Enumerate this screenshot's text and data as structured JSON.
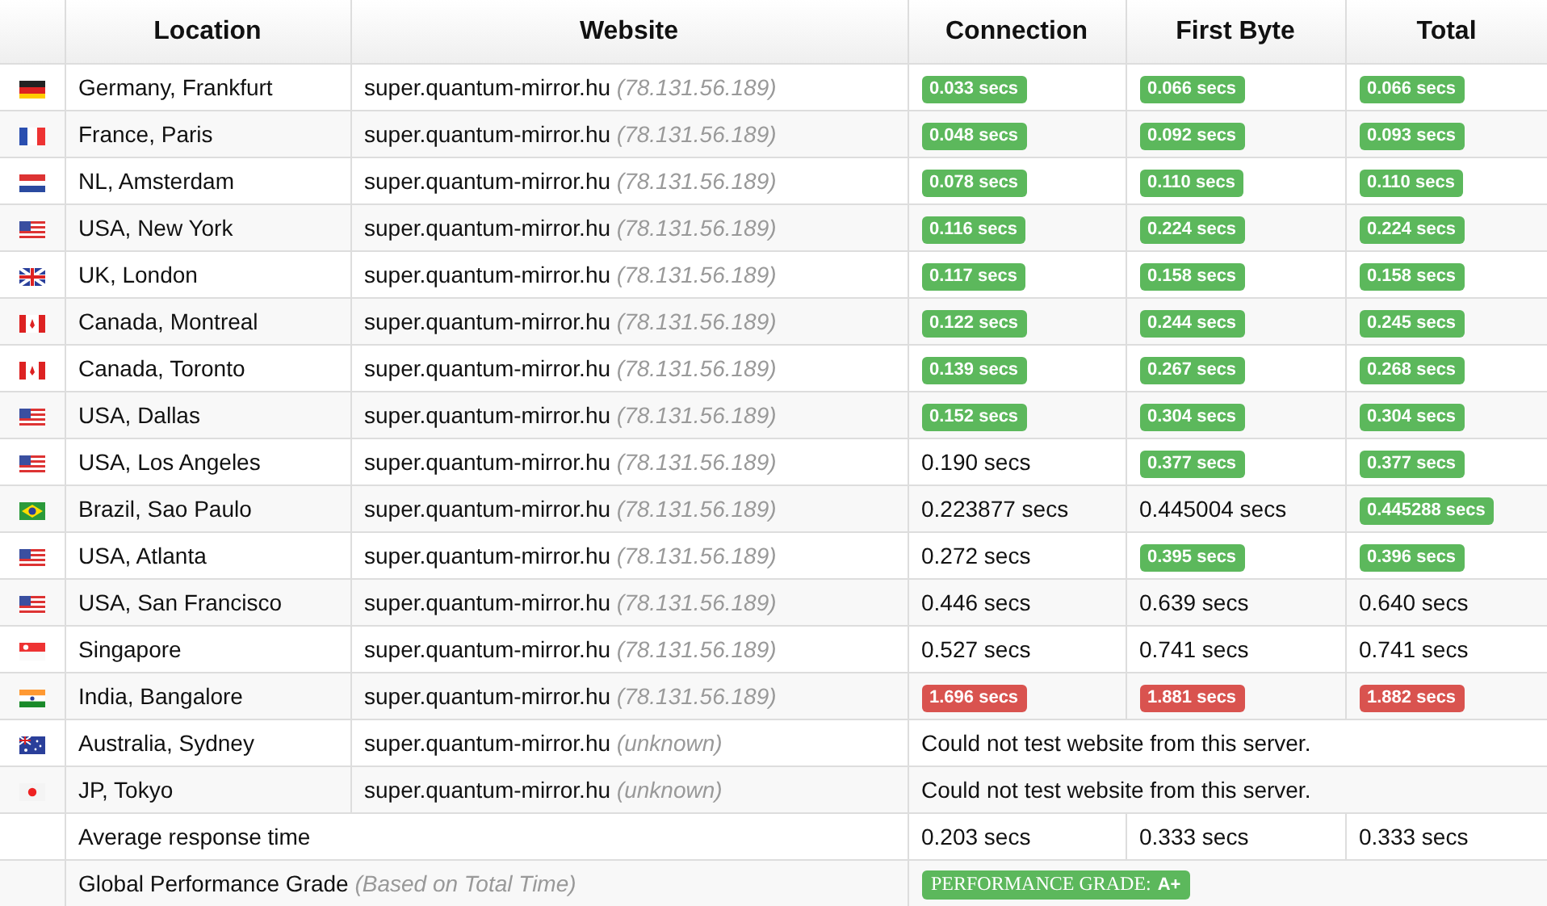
{
  "table": {
    "columns": [
      "Location",
      "Website",
      "Connection",
      "First Byte",
      "Total"
    ],
    "rows": [
      {
        "flag": {
          "kind": "de"
        },
        "location": "Germany, Frankfurt",
        "host": "super.quantum-mirror.hu",
        "ip": "(78.131.56.189)",
        "times": [
          {
            "text": "0.033 secs",
            "color": "#5cb85c"
          },
          {
            "text": "0.066 secs",
            "color": "#5cb85c"
          },
          {
            "text": "0.066 secs",
            "color": "#5cb85c"
          }
        ]
      },
      {
        "flag": {
          "kind": "fr"
        },
        "location": "France, Paris",
        "host": "super.quantum-mirror.hu",
        "ip": "(78.131.56.189)",
        "times": [
          {
            "text": "0.048 secs",
            "color": "#5cb85c"
          },
          {
            "text": "0.092 secs",
            "color": "#5cb85c"
          },
          {
            "text": "0.093 secs",
            "color": "#5cb85c"
          }
        ]
      },
      {
        "flag": {
          "kind": "nl"
        },
        "location": "NL, Amsterdam",
        "host": "super.quantum-mirror.hu",
        "ip": "(78.131.56.189)",
        "times": [
          {
            "text": "0.078 secs",
            "color": "#5cb85c"
          },
          {
            "text": "0.110 secs",
            "color": "#5cb85c"
          },
          {
            "text": "0.110 secs",
            "color": "#5cb85c"
          }
        ]
      },
      {
        "flag": {
          "kind": "us"
        },
        "location": "USA, New York",
        "host": "super.quantum-mirror.hu",
        "ip": "(78.131.56.189)",
        "times": [
          {
            "text": "0.116 secs",
            "color": "#5cb85c"
          },
          {
            "text": "0.224 secs",
            "color": "#5cb85c"
          },
          {
            "text": "0.224 secs",
            "color": "#5cb85c"
          }
        ]
      },
      {
        "flag": {
          "kind": "gb"
        },
        "location": "UK, London",
        "host": "super.quantum-mirror.hu",
        "ip": "(78.131.56.189)",
        "times": [
          {
            "text": "0.117 secs",
            "color": "#5cb85c"
          },
          {
            "text": "0.158 secs",
            "color": "#5cb85c"
          },
          {
            "text": "0.158 secs",
            "color": "#5cb85c"
          }
        ]
      },
      {
        "flag": {
          "kind": "ca"
        },
        "location": "Canada, Montreal",
        "host": "super.quantum-mirror.hu",
        "ip": "(78.131.56.189)",
        "times": [
          {
            "text": "0.122 secs",
            "color": "#5cb85c"
          },
          {
            "text": "0.244 secs",
            "color": "#5cb85c"
          },
          {
            "text": "0.245 secs",
            "color": "#5cb85c"
          }
        ]
      },
      {
        "flag": {
          "kind": "ca"
        },
        "location": "Canada, Toronto",
        "host": "super.quantum-mirror.hu",
        "ip": "(78.131.56.189)",
        "times": [
          {
            "text": "0.139 secs",
            "color": "#5cb85c"
          },
          {
            "text": "0.267 secs",
            "color": "#5cb85c"
          },
          {
            "text": "0.268 secs",
            "color": "#5cb85c"
          }
        ]
      },
      {
        "flag": {
          "kind": "us"
        },
        "location": "USA, Dallas",
        "host": "super.quantum-mirror.hu",
        "ip": "(78.131.56.189)",
        "times": [
          {
            "text": "0.152 secs",
            "color": "#5cb85c"
          },
          {
            "text": "0.304 secs",
            "color": "#5cb85c"
          },
          {
            "text": "0.304 secs",
            "color": "#5cb85c"
          }
        ]
      },
      {
        "flag": {
          "kind": "us"
        },
        "location": "USA, Los Angeles",
        "host": "super.quantum-mirror.hu",
        "ip": "(78.131.56.189)",
        "times": [
          {
            "text": "0.190 secs"
          },
          {
            "text": "0.377 secs",
            "color": "#5cb85c"
          },
          {
            "text": "0.377 secs",
            "color": "#5cb85c"
          }
        ]
      },
      {
        "flag": {
          "kind": "br"
        },
        "location": "Brazil, Sao Paulo",
        "host": "super.quantum-mirror.hu",
        "ip": "(78.131.56.189)",
        "times": [
          {
            "text": "0.223877 secs"
          },
          {
            "text": "0.445004 secs"
          },
          {
            "text": "0.445288 secs",
            "color": "#5cb85c"
          }
        ]
      },
      {
        "flag": {
          "kind": "us"
        },
        "location": "USA, Atlanta",
        "host": "super.quantum-mirror.hu",
        "ip": "(78.131.56.189)",
        "times": [
          {
            "text": "0.272 secs"
          },
          {
            "text": "0.395 secs",
            "color": "#5cb85c"
          },
          {
            "text": "0.396 secs",
            "color": "#5cb85c"
          }
        ]
      },
      {
        "flag": {
          "kind": "us"
        },
        "location": "USA, San Francisco",
        "host": "super.quantum-mirror.hu",
        "ip": "(78.131.56.189)",
        "times": [
          {
            "text": "0.446 secs"
          },
          {
            "text": "0.639 secs"
          },
          {
            "text": "0.640 secs"
          }
        ]
      },
      {
        "flag": {
          "kind": "sg"
        },
        "location": "Singapore",
        "host": "super.quantum-mirror.hu",
        "ip": "(78.131.56.189)",
        "times": [
          {
            "text": "0.527 secs"
          },
          {
            "text": "0.741 secs"
          },
          {
            "text": "0.741 secs"
          }
        ]
      },
      {
        "flag": {
          "kind": "in"
        },
        "location": "India, Bangalore",
        "host": "super.quantum-mirror.hu",
        "ip": "(78.131.56.189)",
        "times": [
          {
            "text": "1.696 secs",
            "color": "#d9534f"
          },
          {
            "text": "1.881 secs",
            "color": "#d9534f"
          },
          {
            "text": "1.882 secs",
            "color": "#d9534f"
          }
        ]
      },
      {
        "flag": {
          "kind": "au"
        },
        "location": "Australia, Sydney",
        "host": "super.quantum-mirror.hu",
        "ip": "(unknown)",
        "message": "Could not test website from this server."
      },
      {
        "flag": {
          "kind": "jp"
        },
        "location": "JP, Tokyo",
        "host": "super.quantum-mirror.hu",
        "ip": "(unknown)",
        "message": "Could not test website from this server."
      }
    ],
    "average": {
      "label": "Average response time",
      "times": [
        "0.203 secs",
        "0.333 secs",
        "0.333 secs"
      ]
    },
    "grade": {
      "label": "Global Performance Grade *(Based on Total Time)*",
      "badge_label": "PERFORMANCE GRADE:",
      "badge_value": "A+"
    }
  }
}
